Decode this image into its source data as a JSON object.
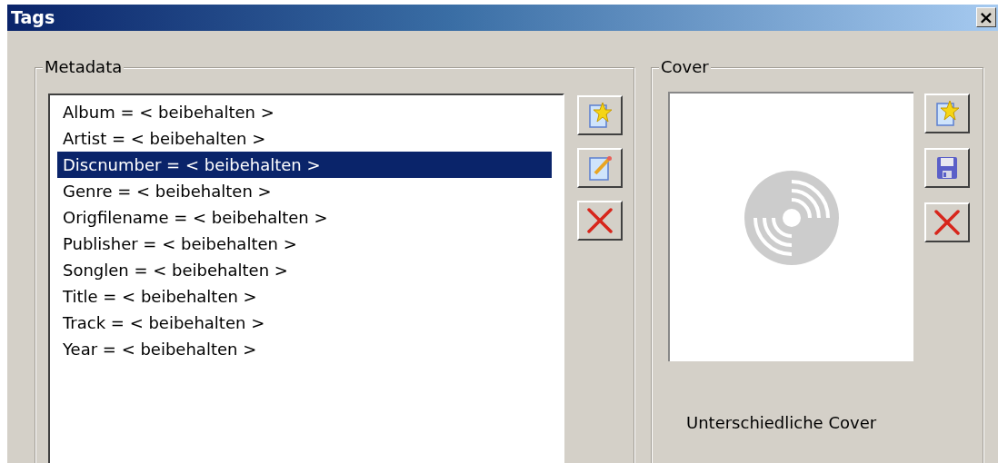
{
  "window": {
    "title": "Tags",
    "close": "×"
  },
  "metadata": {
    "title": "Metadata",
    "items": [
      {
        "label": "Album = < beibehalten >",
        "selected": false
      },
      {
        "label": "Artist = < beibehalten >",
        "selected": false
      },
      {
        "label": "Discnumber = < beibehalten >",
        "selected": true
      },
      {
        "label": "Genre = < beibehalten >",
        "selected": false
      },
      {
        "label": "Origfilename = < beibehalten >",
        "selected": false
      },
      {
        "label": "Publisher = < beibehalten >",
        "selected": false
      },
      {
        "label": "Songlen = < beibehalten >",
        "selected": false
      },
      {
        "label": "Title = < beibehalten >",
        "selected": false
      },
      {
        "label": "Track = < beibehalten >",
        "selected": false
      },
      {
        "label": "Year = < beibehalten >",
        "selected": false
      }
    ],
    "buttons": [
      {
        "kind": "new"
      },
      {
        "kind": "edit"
      },
      {
        "kind": "delete"
      }
    ]
  },
  "cover": {
    "title": "Cover",
    "caption": "Unterschiedliche Cover",
    "buttons": [
      {
        "kind": "new"
      },
      {
        "kind": "save"
      },
      {
        "kind": "delete"
      }
    ]
  }
}
